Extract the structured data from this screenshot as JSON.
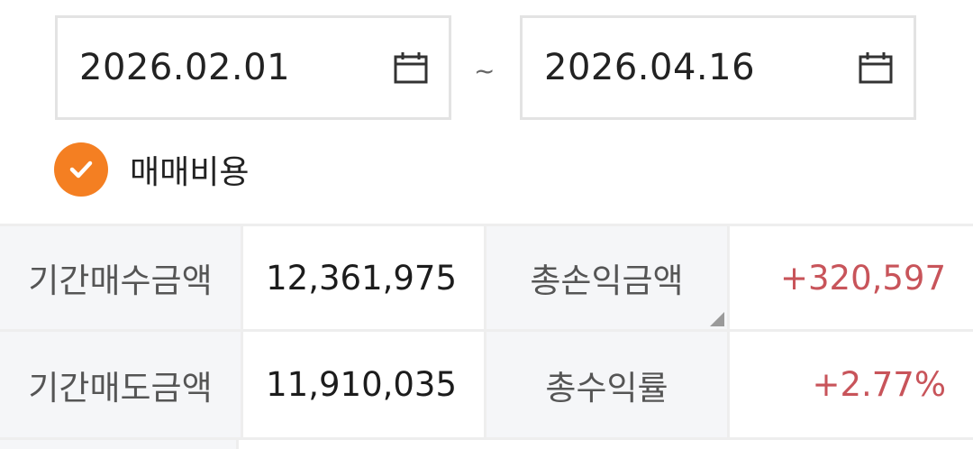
{
  "date_range": {
    "start": "2026.02.01",
    "separator": "~",
    "end": "2026.04.16"
  },
  "icons": {
    "calendar": "calendar-icon",
    "check": "check-icon"
  },
  "options": {
    "trading_cost": {
      "label": "매매비용",
      "checked": true
    }
  },
  "summary": {
    "buy_amount_label": "기간매수금액",
    "buy_amount_value": "12,361,975",
    "total_pnl_label": "총손익금액",
    "total_pnl_value": "+320,597",
    "sell_amount_label": "기간매도금액",
    "sell_amount_value": "11,910,035",
    "total_return_label": "총수익률",
    "total_return_value": "+2.77%"
  },
  "colors": {
    "accent": "#f47f22",
    "positive": "#c8545a",
    "label_bg": "#f5f6f8",
    "border": "#e3e3e3"
  }
}
